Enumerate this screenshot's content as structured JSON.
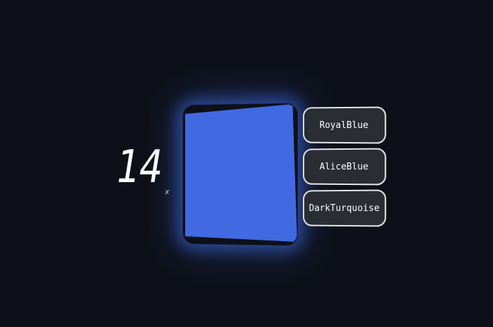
{
  "counter": {
    "value": "14",
    "suffix": "x"
  },
  "swatch": {
    "color": "#4169e1"
  },
  "options": [
    {
      "label": "RoyalBlue"
    },
    {
      "label": "AliceBlue"
    },
    {
      "label": "DarkTurquoise"
    }
  ],
  "colors": {
    "background": "#0d1018",
    "option_background": "#2a2d33",
    "option_border": "#e6e7ea"
  }
}
